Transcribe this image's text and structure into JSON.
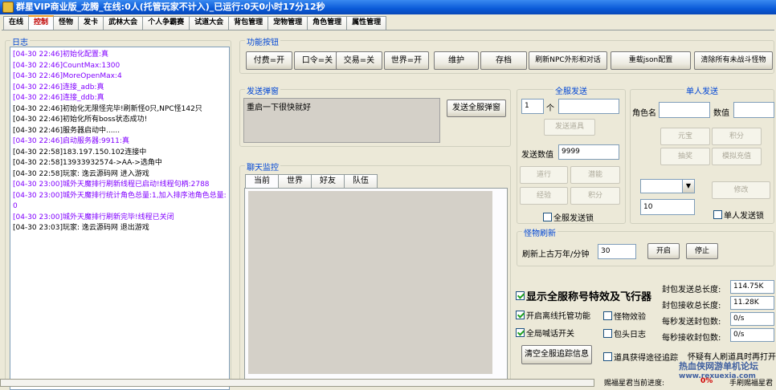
{
  "window": {
    "title": "群星VIP商业版_龙腾_在线:0人(托管玩家不计入)_已运行:0天0小时17分12秒"
  },
  "tabs": [
    "在线",
    "控制",
    "怪物",
    "发卡",
    "武林大会",
    "个人争霸赛",
    "试道大会",
    "背包管理",
    "宠物管理",
    "角色管理",
    "属性管理"
  ],
  "active_tab": 1,
  "log": {
    "title": "日志",
    "lines": [
      {
        "text": "[04-30 22:46]初始化配置:真",
        "color": "purple"
      },
      {
        "text": "[04-30 22:46]CountMax:1300",
        "color": "purple"
      },
      {
        "text": "[04-30 22:46]MoreOpenMax:4",
        "color": "purple"
      },
      {
        "text": "[04-30 22:46]连接_adb:真",
        "color": "purple"
      },
      {
        "text": "[04-30 22:46]连接_ddb:真",
        "color": "purple"
      },
      {
        "text": "[04-30 22:46]初始化无限怪完毕!刷新怪0只,NPC怪142只",
        "color": "black"
      },
      {
        "text": "[04-30 22:46]初始化所有boss状态成功!",
        "color": "black"
      },
      {
        "text": "[04-30 22:46]服务器启动中......",
        "color": "black"
      },
      {
        "text": "[04-30 22:46]启动服务器:9911:真",
        "color": "purple"
      },
      {
        "text": "[04-30 22:58]183.197.150.102连接中",
        "color": "black"
      },
      {
        "text": "[04-30 22:58]13933932574->AA->选角中",
        "color": "black"
      },
      {
        "text": "[04-30 22:58]玩家: 逸云源码网  进入游戏",
        "color": "black"
      },
      {
        "text": "[04-30 23:00]城外天魔排行刷新线程已启动!线程句柄:2788",
        "color": "purple"
      },
      {
        "text": "[04-30 23:00]城外天魔排行统计角色总量:1,加入排序池角色总量:0",
        "color": "purple"
      },
      {
        "text": "[04-30 23:00]城外天魔排行刷新完毕!线程已关闭",
        "color": "purple"
      },
      {
        "text": "[04-30 23:03]玩家: 逸云源码网  退出游戏",
        "color": "black"
      }
    ]
  },
  "func": {
    "title": "功能按钮",
    "buttons": [
      "付费=开",
      "口令=关",
      "交易=关",
      "世界=开",
      "维护",
      "存档",
      "刷新NPC外形和对话",
      "重载json配置",
      "清除所有未战斗怪物"
    ]
  },
  "popup": {
    "title": "发送弹窗",
    "text": "重启一下很快就好",
    "send_button": "发送全服弹窗"
  },
  "chat": {
    "title": "聊天监控",
    "tabs": [
      "当前",
      "世界",
      "好友",
      "队伍"
    ]
  },
  "server_send": {
    "title": "全服发送",
    "qty": "1",
    "unit": "个",
    "send_item": "发送道具",
    "send_value_label": "发送数值",
    "send_value": "9999",
    "buttons": [
      "道行",
      "潜能",
      "经验",
      "积分"
    ],
    "lock_label": "全服发送锁"
  },
  "single_send": {
    "title": "单人发送",
    "role_label": "角色名",
    "value_label": "数值",
    "buttons": [
      "元宝",
      "积分",
      "抽奖",
      "模拟充值"
    ],
    "modify": "修改",
    "num": "10",
    "lock_label": "单人发送锁"
  },
  "monster_refresh": {
    "title": "怪物刷新",
    "label": "刷新上古万年/分钟",
    "value": "30",
    "start": "开启",
    "stop": "停止"
  },
  "options": {
    "show_title": "显示全服称号特效及飞行器",
    "offline": "开启离线托管功能",
    "monster_effect": "怪物效验",
    "broadcast": "全局喊话开关",
    "package_log": "包头日志",
    "clear_trace": "清空全服追踪信息",
    "item_trace": "道具获得途径追踪",
    "hint": "怀疑有人刷道具时再打开"
  },
  "stats": [
    {
      "label": "封包发送总长度:",
      "value": "114.75K"
    },
    {
      "label": "封包接收总长度:",
      "value": "11.28K"
    },
    {
      "label": "每秒发送封包数:",
      "value": "0/s"
    },
    {
      "label": "每秒接收封包数:",
      "value": "0/s"
    }
  ],
  "status": {
    "progress_label": "赐福星君当前进度:",
    "progress_value": "0%",
    "right": "手刷赐福星君"
  },
  "watermark": {
    "line1": "热血侠网游单机论坛",
    "line2": "www.rexuexia.com"
  }
}
